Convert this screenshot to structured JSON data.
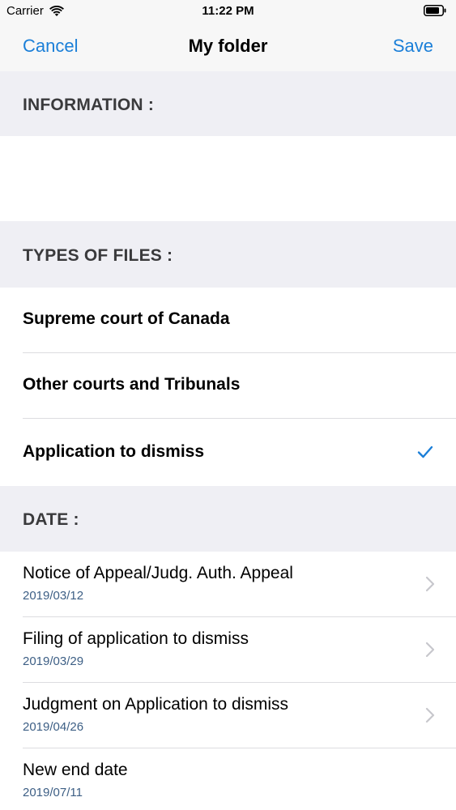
{
  "status_bar": {
    "carrier": "Carrier",
    "time": "11:22 PM"
  },
  "nav": {
    "cancel": "Cancel",
    "title": "My folder",
    "save": "Save"
  },
  "sections": {
    "information": "INFORMATION :",
    "types": "TYPES OF FILES :",
    "date": "DATE :"
  },
  "types": [
    {
      "label": "Supreme court of Canada",
      "checked": false
    },
    {
      "label": "Other courts and Tribunals",
      "checked": false
    },
    {
      "label": "Application to dismiss",
      "checked": true
    }
  ],
  "dates": [
    {
      "title": "Notice of Appeal/Judg. Auth. Appeal",
      "date": "2019/03/12",
      "chevron": true
    },
    {
      "title": "Filing of application to dismiss",
      "date": "2019/03/29",
      "chevron": true
    },
    {
      "title": "Judgment on Application to dismiss",
      "date": "2019/04/26",
      "chevron": true
    },
    {
      "title": "New end date",
      "date": "2019/07/11",
      "chevron": false
    }
  ],
  "colors": {
    "accent": "#1b7fd8",
    "date_text": "#3d5f85",
    "section_bg": "#efeff4"
  },
  "icons": [
    "wifi-icon",
    "battery-icon",
    "checkmark-icon",
    "chevron-right-icon"
  ]
}
